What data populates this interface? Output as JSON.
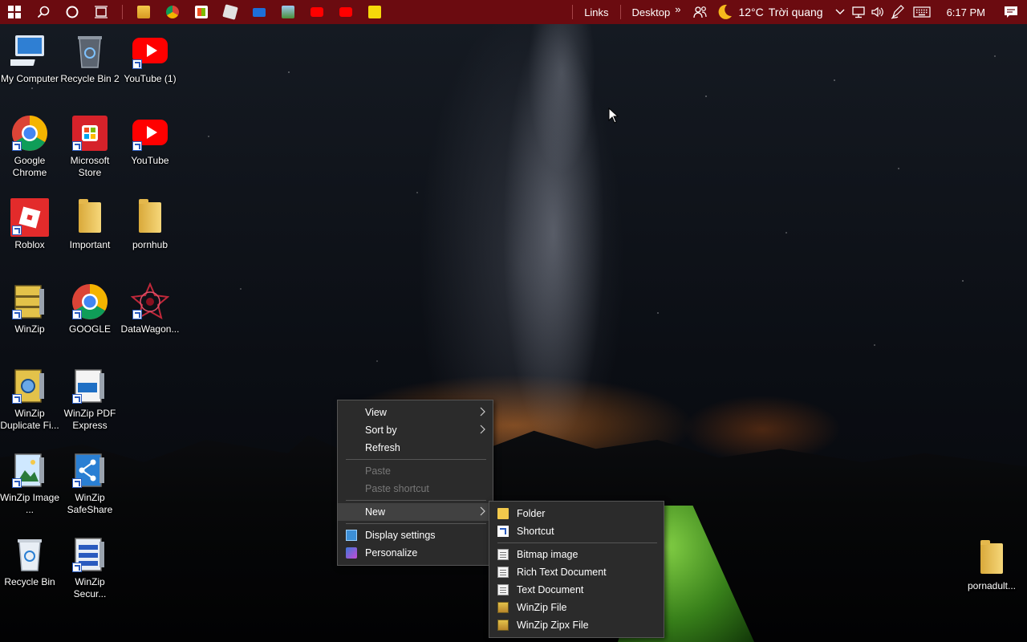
{
  "taskbar": {
    "toolbars": [
      "Links",
      "Desktop"
    ],
    "overflow_glyph": "»",
    "weather": {
      "temperature": "12°C",
      "condition": "Trời quang"
    },
    "clock": "6:17 PM",
    "color": "#6b0b10"
  },
  "desktop": {
    "icons": [
      {
        "label": "My Computer",
        "icon": "computer-icon"
      },
      {
        "label": "Recycle Bin 2",
        "icon": "recycle-bin-icon"
      },
      {
        "label": "YouTube (1)",
        "icon": "youtube-icon"
      },
      {
        "label": "Google Chrome",
        "icon": "chrome-icon"
      },
      {
        "label": "Microsoft Store",
        "icon": "store-icon"
      },
      {
        "label": "YouTube",
        "icon": "youtube-icon"
      },
      {
        "label": "Roblox",
        "icon": "roblox-icon"
      },
      {
        "label": "Important",
        "icon": "folder-icon"
      },
      {
        "label": "pornhub",
        "icon": "folder-icon"
      },
      {
        "label": "WinZip",
        "icon": "winzip-icon"
      },
      {
        "label": "GOOGLE",
        "icon": "chrome-icon"
      },
      {
        "label": "DataWagon...",
        "icon": "datawagon-icon"
      },
      {
        "label": "WinZip Duplicate Fi...",
        "icon": "winzip-icon"
      },
      {
        "label": "WinZip PDF Express",
        "icon": "winzip-pdf-icon"
      },
      {
        "label": "WinZip Image ...",
        "icon": "winzip-image-icon"
      },
      {
        "label": "WinZip SafeShare",
        "icon": "winzip-share-icon"
      },
      {
        "label": "Recycle Bin",
        "icon": "recycle-bin-icon"
      },
      {
        "label": "WinZip Secur...",
        "icon": "winzip-secure-icon"
      },
      {
        "label": "pornadult...",
        "icon": "folder-icon"
      }
    ]
  },
  "context_menu": {
    "items": [
      {
        "label": "View",
        "submenu": true
      },
      {
        "label": "Sort by",
        "submenu": true
      },
      {
        "label": "Refresh"
      },
      {
        "label": "Paste",
        "disabled": true
      },
      {
        "label": "Paste shortcut",
        "disabled": true
      },
      {
        "label": "New",
        "submenu": true,
        "active": true
      },
      {
        "label": "Display settings",
        "icon": "display-settings-icon"
      },
      {
        "label": "Personalize",
        "icon": "personalize-icon"
      }
    ]
  },
  "new_submenu": {
    "items": [
      {
        "label": "Folder",
        "icon": "folder-icon"
      },
      {
        "label": "Shortcut",
        "icon": "shortcut-icon"
      },
      {
        "label": "Bitmap image",
        "icon": "bitmap-icon"
      },
      {
        "label": "Rich Text Document",
        "icon": "rich-text-icon"
      },
      {
        "label": "Text Document",
        "icon": "text-document-icon"
      },
      {
        "label": "WinZip File",
        "icon": "winzip-file-icon"
      },
      {
        "label": "WinZip Zipx File",
        "icon": "winzip-zipx-icon"
      }
    ]
  }
}
